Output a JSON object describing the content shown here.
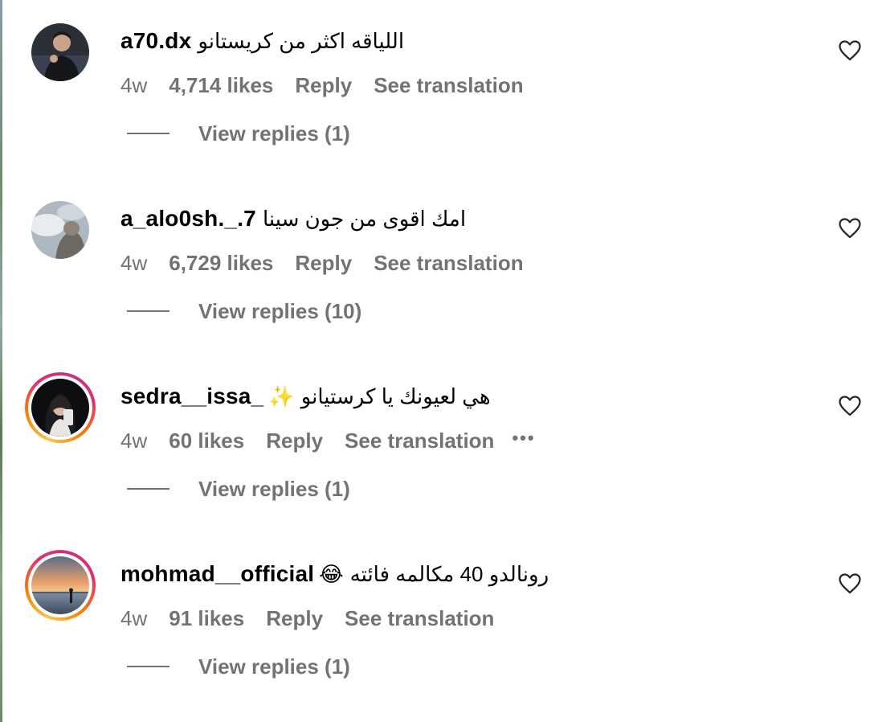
{
  "comments": [
    {
      "username": "a70.dx",
      "text": "اللياقه اكثر من كريستانو",
      "emoji": "",
      "time": "4w",
      "likes": "4,714 likes",
      "reply": "Reply",
      "translation": "See translation",
      "more": "",
      "view_replies": "View replies (1)",
      "avatar_ring": false
    },
    {
      "username": "a_alo0sh._.7",
      "text": "امك اقوى من جون سينا",
      "emoji": "",
      "time": "4w",
      "likes": "6,729 likes",
      "reply": "Reply",
      "translation": "See translation",
      "more": "",
      "view_replies": "View replies (10)",
      "avatar_ring": false
    },
    {
      "username": "sedra__issa_",
      "text": "هي لعيونك يا كرستيانو",
      "emoji": "✨",
      "time": "4w",
      "likes": "60 likes",
      "reply": "Reply",
      "translation": "See translation",
      "more": "•••",
      "view_replies": "View replies (1)",
      "avatar_ring": true
    },
    {
      "username": "mohmad__official",
      "text": "رونالدو 40 مكالمه فائته",
      "emoji": "😂",
      "time": "4w",
      "likes": "91 likes",
      "reply": "Reply",
      "translation": "See translation",
      "more": "",
      "view_replies": "View replies (1)",
      "avatar_ring": true
    }
  ],
  "icons": {
    "like": "heart-outline-icon",
    "more": "more-options-icon"
  },
  "colors": {
    "secondary_text": "#737373",
    "primary_text": "#000000",
    "story_ring": [
      "#f9c74f",
      "#f77f00",
      "#e1306c",
      "#c13584"
    ]
  }
}
